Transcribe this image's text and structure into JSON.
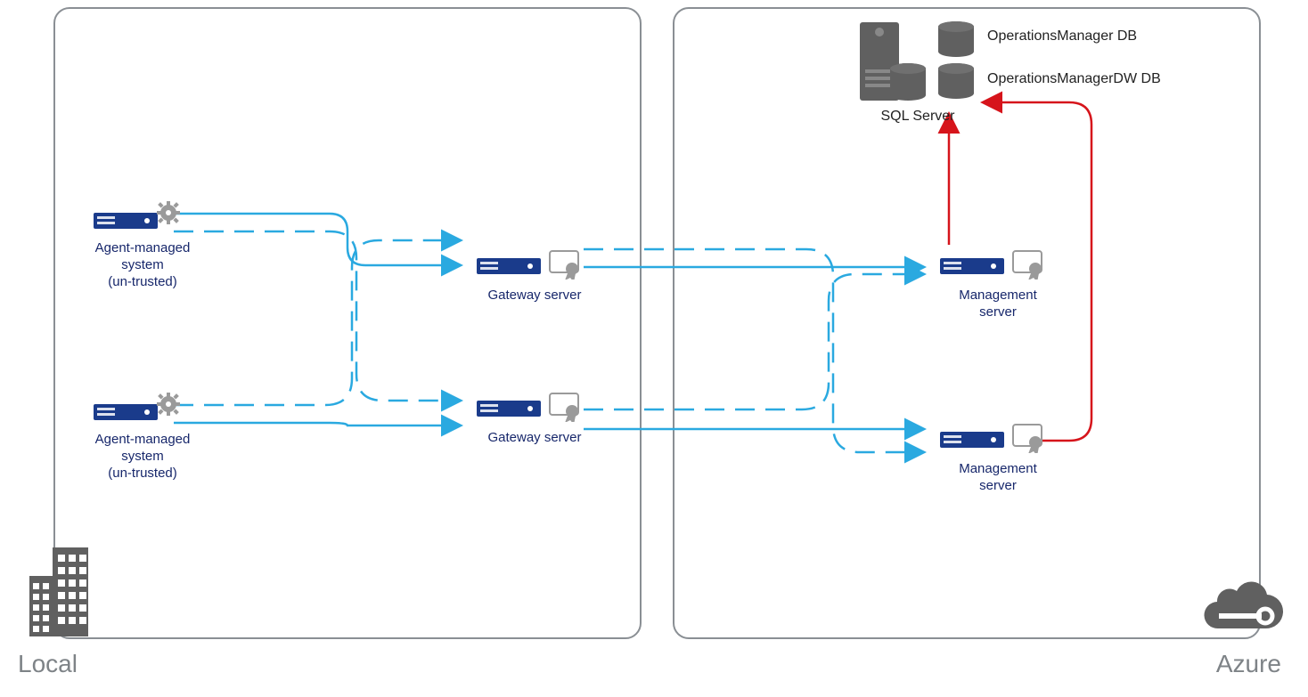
{
  "regions": {
    "local": "Local",
    "azure": "Azure"
  },
  "nodes": {
    "agent1": "Agent-managed\nsystem\n(un-trusted)",
    "agent2": "Agent-managed\nsystem\n(un-trusted)",
    "gw1": "Gateway server",
    "gw2": "Gateway server",
    "mgmt1": "Management\nserver",
    "mgmt2": "Management\nserver",
    "sql": "SQL Server",
    "db1": "OperationsManager DB",
    "db2": "OperationsManagerDW DB"
  },
  "colors": {
    "blue": "#2aa9e0",
    "navy": "#1a3b8b",
    "red": "#d6141b",
    "grey": "#606060"
  }
}
